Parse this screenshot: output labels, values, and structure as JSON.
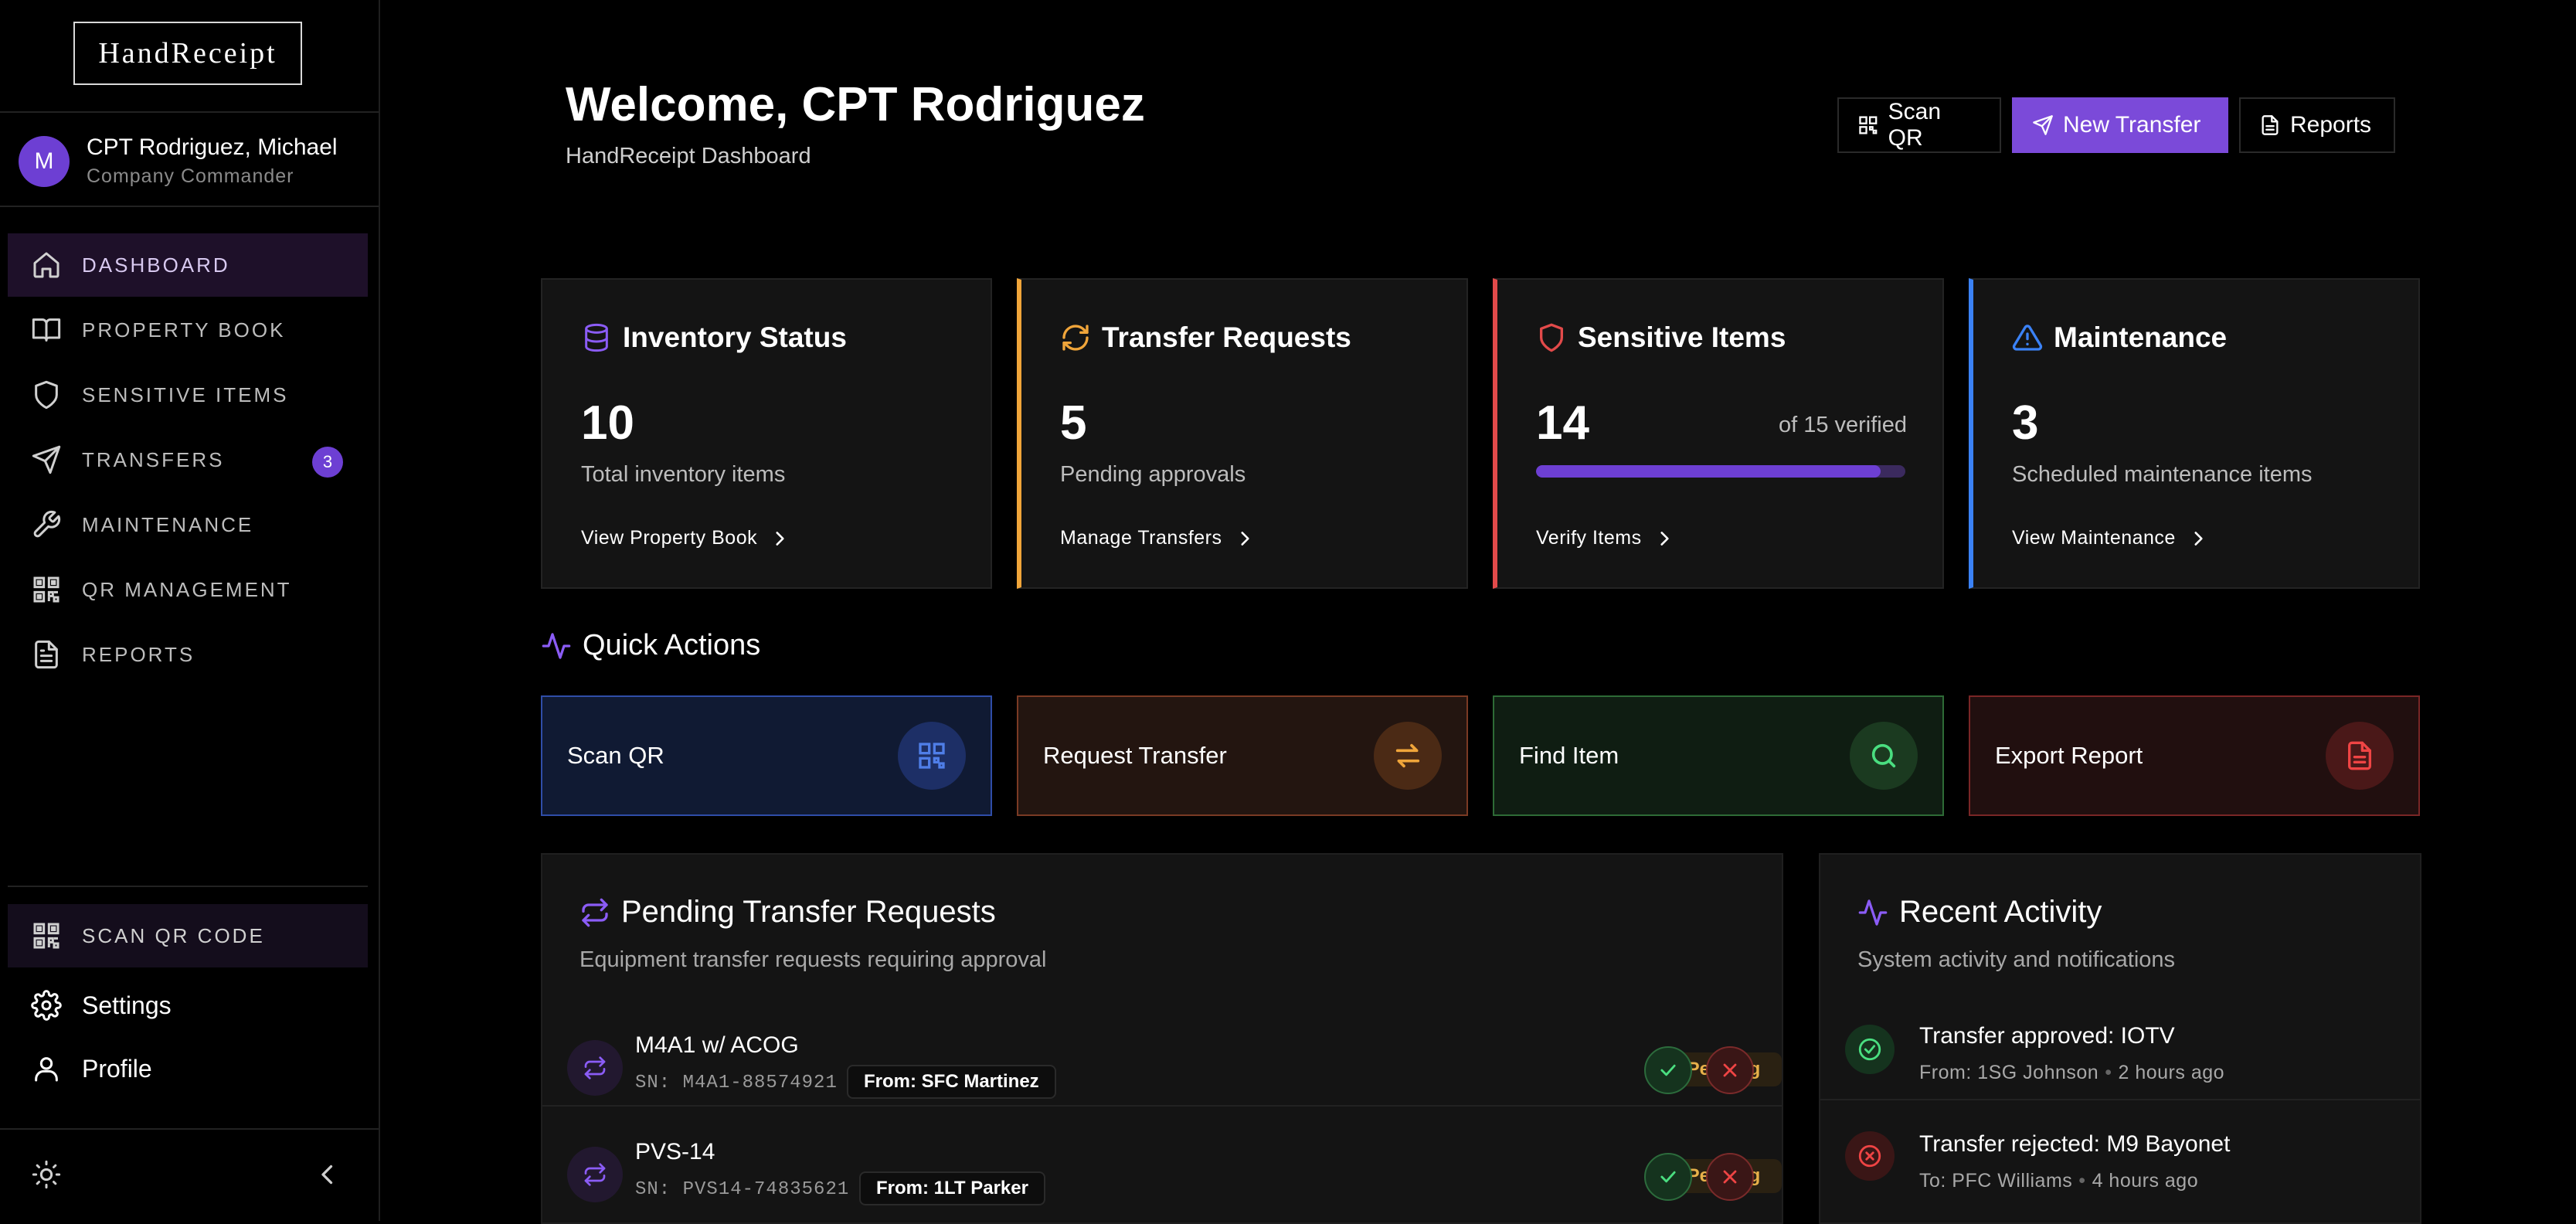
{
  "app": {
    "logo": "HandReceipt"
  },
  "user": {
    "initial": "M",
    "name": "CPT Rodriguez, Michael",
    "role": "Company Commander"
  },
  "sidebar": {
    "items": [
      {
        "label": "DASHBOARD",
        "icon": "home-icon"
      },
      {
        "label": "PROPERTY BOOK",
        "icon": "book-icon"
      },
      {
        "label": "SENSITIVE ITEMS",
        "icon": "shield-icon"
      },
      {
        "label": "TRANSFERS",
        "icon": "send-icon",
        "badge": "3"
      },
      {
        "label": "MAINTENANCE",
        "icon": "wrench-icon"
      },
      {
        "label": "QR MANAGEMENT",
        "icon": "qr-icon"
      },
      {
        "label": "REPORTS",
        "icon": "file-icon"
      }
    ],
    "scan_label": "SCAN QR CODE",
    "settings_label": "Settings",
    "profile_label": "Profile"
  },
  "header": {
    "title": "Welcome, CPT Rodriguez",
    "subtitle": "HandReceipt Dashboard",
    "scan_label": "Scan QR",
    "new_transfer_label": "New Transfer",
    "reports_label": "Reports"
  },
  "cards": [
    {
      "title": "Inventory Status",
      "value": "10",
      "desc": "Total inventory items",
      "link": "View Property Book",
      "accent": "#8b5cf6"
    },
    {
      "title": "Transfer Requests",
      "value": "5",
      "desc": "Pending approvals",
      "link": "Manage Transfers",
      "accent": "#f0a53a"
    },
    {
      "title": "Sensitive Items",
      "value": "14",
      "extra": "of 15 verified",
      "progress": 0.933,
      "link": "Verify Items",
      "accent": "#e24a4a"
    },
    {
      "title": "Maintenance",
      "value": "3",
      "desc": "Scheduled maintenance items",
      "link": "View Maintenance",
      "accent": "#3b82f6"
    }
  ],
  "quick_actions": {
    "title": "Quick Actions",
    "items": [
      {
        "label": "Scan QR",
        "icon": "qr-icon"
      },
      {
        "label": "Request Transfer",
        "icon": "arrows-icon"
      },
      {
        "label": "Find Item",
        "icon": "search-icon"
      },
      {
        "label": "Export Report",
        "icon": "file-icon"
      }
    ]
  },
  "pending": {
    "title": "Pending Transfer Requests",
    "subtitle": "Equipment transfer requests requiring approval",
    "rows": [
      {
        "name": "M4A1 w/ ACOG",
        "sn": "SN: M4A1-88574921",
        "from": "From: SFC Martinez",
        "status": "Pending"
      },
      {
        "name": "PVS-14",
        "sn": "SN: PVS14-74835621",
        "from": "From: 1LT Parker",
        "status": "Pending"
      }
    ]
  },
  "activity": {
    "title": "Recent Activity",
    "subtitle": "System activity and notifications",
    "rows": [
      {
        "title": "Transfer approved: IOTV",
        "who": "From: 1SG Johnson",
        "time": "2 hours ago",
        "kind": "approved"
      },
      {
        "title": "Transfer rejected: M9 Bayonet",
        "who": "To: PFC Williams",
        "time": "4 hours ago",
        "kind": "rejected"
      }
    ]
  },
  "colors": {
    "accent": "#7b4ad9",
    "approve": "#4ade80",
    "reject": "#ef4444",
    "pending": "#e8b14a"
  }
}
